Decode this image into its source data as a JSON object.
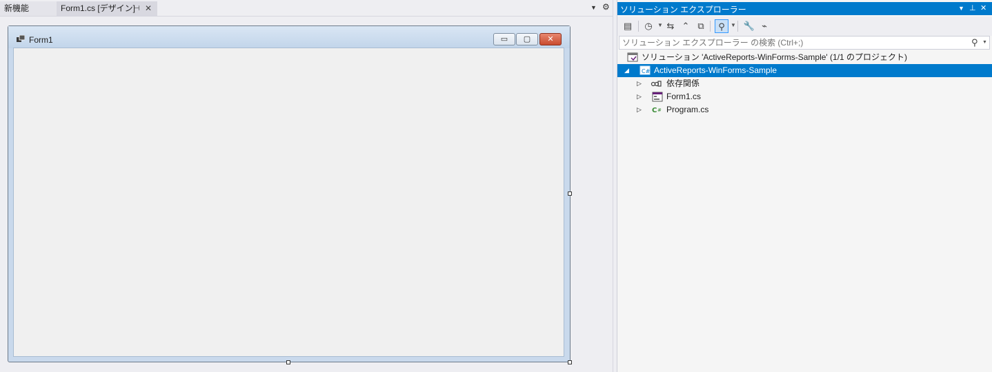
{
  "tabs": {
    "new_features": "新機能",
    "form_design": "Form1.cs [デザイン]"
  },
  "designer": {
    "form_title": "Form1"
  },
  "solution_explorer": {
    "title": "ソリューション エクスプローラー",
    "search_placeholder": "ソリューション エクスプローラー の検索 (Ctrl+;)",
    "tree": {
      "solution": "ソリューション 'ActiveReports-WinForms-Sample' (1/1 のプロジェクト)",
      "project": "ActiveReports-WinForms-Sample",
      "dependencies": "依存関係",
      "form1": "Form1.cs",
      "program": "Program.cs"
    }
  },
  "colors": {
    "accent": "#007acc",
    "background": "#eeeef2",
    "form_client": "#f0f0f0",
    "close_button": "#c84b2f"
  },
  "icons": {
    "pin": "pin-icon",
    "close": "close-icon",
    "settings": "gear-icon",
    "search": "search-icon"
  }
}
